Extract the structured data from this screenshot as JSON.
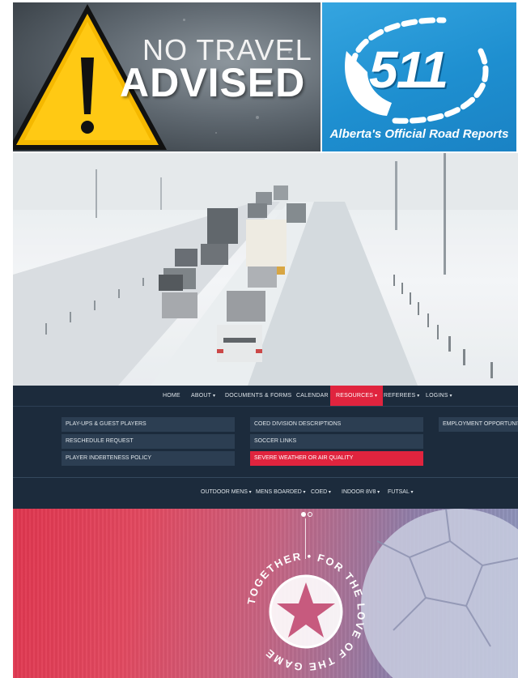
{
  "banner_left": {
    "line1": "NO TRAVEL",
    "line2": "ADVISED",
    "icon": "warning-triangle-icon"
  },
  "banner_right": {
    "logo_number": "511",
    "caption": "Alberta's Official Road Reports",
    "icon": "phone-icon"
  },
  "photo": {
    "subject": "snowy-highway-traffic"
  },
  "navbar": {
    "items": [
      "HOME",
      "ABOUT",
      "DOCUMENTS & FORMS",
      "CALENDAR",
      "RESOURCES",
      "REFEREES",
      "LOGINS"
    ],
    "active": "RESOURCES"
  },
  "dropdown": {
    "col1": [
      "PLAY-UPS & GUEST PLAYERS",
      "RESCHEDULE REQUEST",
      "PLAYER INDEBTENESS POLICY"
    ],
    "col2": [
      "COED DIVISION DESCRIPTIONS",
      "SOCCER LINKS",
      "SEVERE WEATHER OR AIR QUALITY"
    ],
    "col3": [
      "EMPLOYMENT OPPORTUNITIES"
    ]
  },
  "subnav": {
    "items": [
      "OUTDOOR MENS",
      "MENS BOARDED",
      "COED",
      "INDOOR 8V8",
      "FUTSAL"
    ]
  },
  "hero": {
    "circle_text": "TOGETHER FOR THE LOVE OF THE GAME",
    "slides_total": 2,
    "slide_active": 1
  },
  "colors": {
    "nav_bg": "#1c2b3c",
    "accent": "#e0243e",
    "sky_blue": "#1e8fd0"
  }
}
